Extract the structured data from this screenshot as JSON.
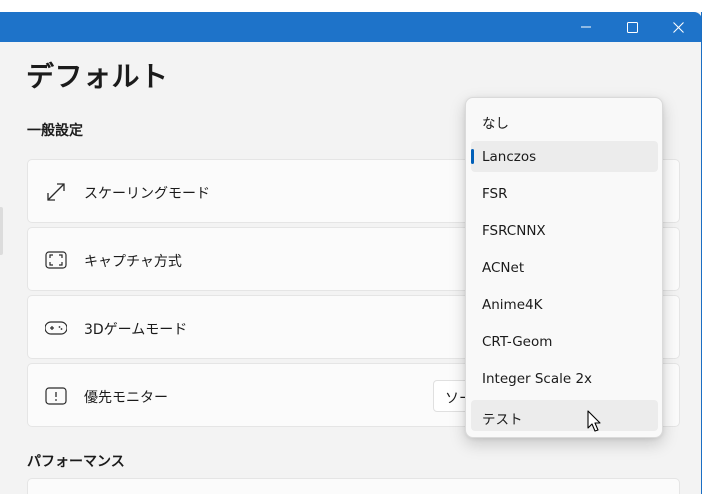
{
  "page": {
    "title": "デフォルト"
  },
  "titlebar": {
    "accent_color": "#1e73c9",
    "buttons": [
      "minimize-icon",
      "maximize-icon",
      "close-icon"
    ]
  },
  "sections": {
    "general": "一般設定",
    "performance": "パフォーマンス"
  },
  "cards": {
    "scaling": {
      "label": "スケーリングモード",
      "icon": "resize-arrows-icon"
    },
    "capture": {
      "label": "キャプチャ方式",
      "icon": "capture-frame-icon"
    },
    "game3d": {
      "label": "3Dゲームモード",
      "icon": "gamepad-icon"
    },
    "monitor": {
      "label": "優先モニター",
      "icon": "monitor-icon",
      "value": "ソー"
    }
  },
  "dropdown": {
    "selected": "Lanczos",
    "items": [
      "なし",
      "Lanczos",
      "FSR",
      "FSRCNNX",
      "ACNet",
      "Anime4K",
      "CRT-Geom",
      "Integer Scale 2x",
      "テスト"
    ],
    "selection_color": "#005fb8"
  }
}
